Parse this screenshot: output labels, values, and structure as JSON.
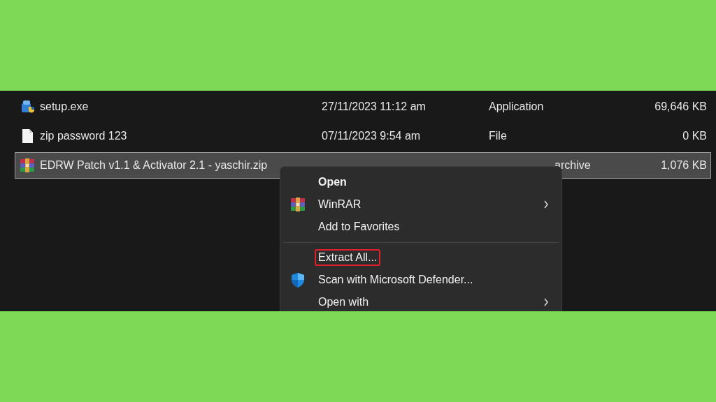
{
  "files": [
    {
      "name": "setup.exe",
      "modified": "27/11/2023 11:12 am",
      "type": "Application",
      "size": "69,646 KB",
      "selected": false
    },
    {
      "name": "zip password 123",
      "modified": "07/11/2023 9:54 am",
      "type": "File",
      "size": "0 KB",
      "selected": false
    },
    {
      "name": "EDRW Patch v1.1 & Activator 2.1 - yaschir.zip",
      "type": "archive",
      "size": "1,076 KB",
      "selected": true
    }
  ],
  "context_menu": {
    "items": [
      {
        "kind": "item",
        "label": "Open",
        "bold": true,
        "submenu": false,
        "highlighted": false
      },
      {
        "kind": "item",
        "label": "WinRAR",
        "bold": false,
        "submenu": true,
        "highlighted": false
      },
      {
        "kind": "item",
        "label": "Add to Favorites",
        "bold": false,
        "submenu": false,
        "highlighted": false
      },
      {
        "kind": "separator"
      },
      {
        "kind": "item",
        "label": "Extract All...",
        "bold": false,
        "submenu": false,
        "highlighted": true
      },
      {
        "kind": "item",
        "label": "Scan with Microsoft Defender...",
        "bold": false,
        "submenu": false,
        "highlighted": false
      },
      {
        "kind": "item",
        "label": "Open with",
        "bold": false,
        "submenu": true,
        "highlighted": false
      }
    ]
  }
}
